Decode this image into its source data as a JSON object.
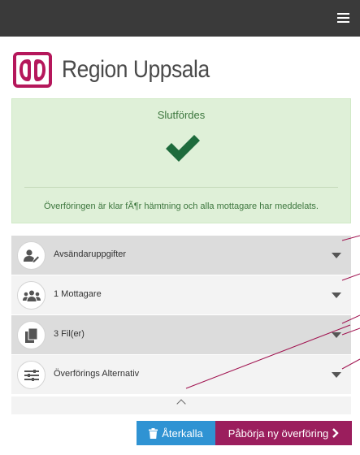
{
  "header": {
    "menu_icon": "hamburger-icon",
    "background": "#3a3a3a"
  },
  "logo": {
    "icon": "region-uppsala-logo-icon",
    "text": "Region Uppsala",
    "brand_color": "#b5175b"
  },
  "status": {
    "title": "Slutfördes",
    "icon": "checkmark-icon",
    "message": "Överföringen är klar fÃ¶r hämtning och alla mottagare har meddelats.",
    "background": "#dff0d8",
    "check_color": "#1e6b3c"
  },
  "sections": [
    {
      "label": "Avsändaruppgifter",
      "icon": "user-edit-icon",
      "caret": "chevron-down-icon"
    },
    {
      "label": "1 Mottagare",
      "icon": "users-icon",
      "caret": "chevron-down-icon"
    },
    {
      "label": "3 Fil(er)",
      "icon": "files-icon",
      "caret": "chevron-down-icon"
    },
    {
      "label": "Överförings Alternativ",
      "icon": "sliders-icon",
      "caret": "chevron-down-icon"
    }
  ],
  "collapse_icon": "chevron-up-icon",
  "buttons": {
    "recall": {
      "label": "Återkalla",
      "icon": "trash-icon",
      "color": "#2f93d3"
    },
    "new_transfer": {
      "label": "Påbörja ny överföring",
      "icon": "chevron-right-icon",
      "color": "#9b1e5d"
    }
  },
  "annotation_line_color": "#a0124f"
}
